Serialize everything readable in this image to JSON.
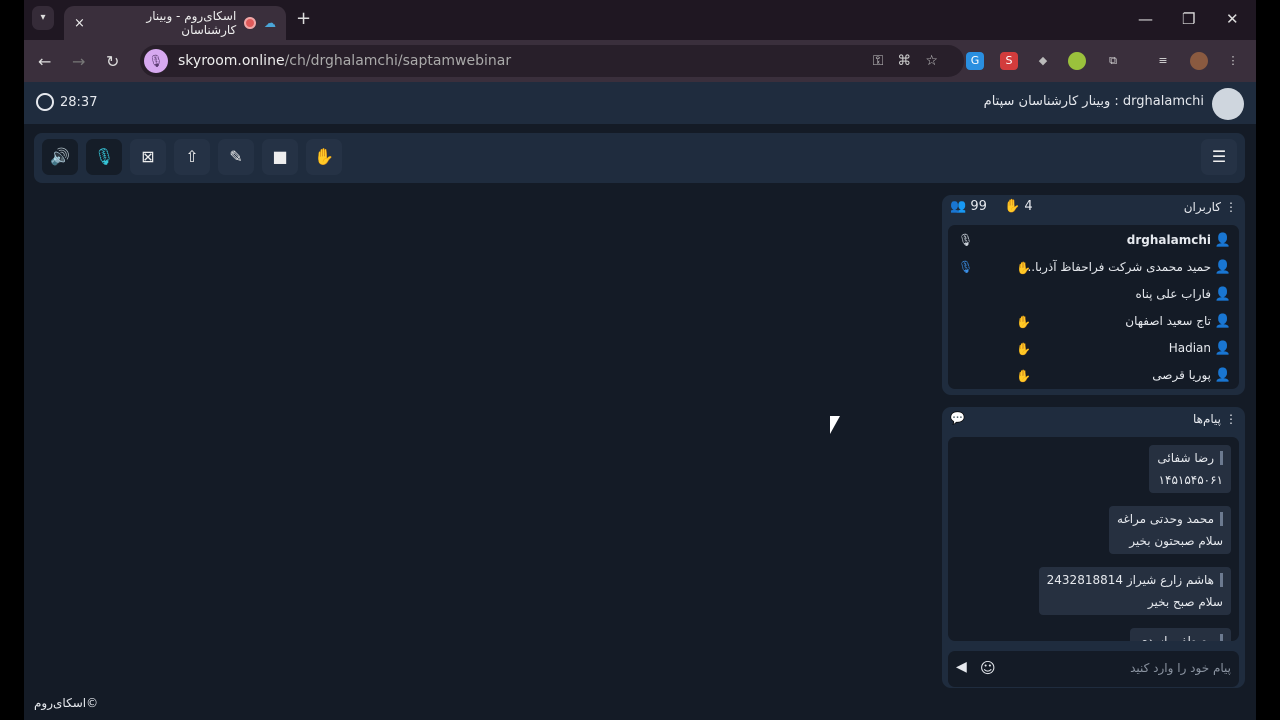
{
  "browser": {
    "tab_title": "اسکای‌روم - وبینار کارشناسان",
    "url_host": "skyroom.online",
    "url_path": "/ch/drghalamchi/saptamwebinar",
    "new_tab": "+",
    "close": "×"
  },
  "app": {
    "timer": "28:37",
    "room_title": "drghalamchi : وبینار کارشناسان سپتام",
    "footer": "©اسکای‌روم"
  },
  "users": {
    "title": "کاربران",
    "count": "99",
    "hands": "4",
    "list": [
      {
        "name": "drghalamchi",
        "color": "#3b8fe6",
        "hand": false,
        "mic": "#cfd6de"
      },
      {
        "name": "حمید محمدی شرکت فراحفاظ آذربا...",
        "color": "#6ee03c",
        "hand": true,
        "mic": "#3b8fe6"
      },
      {
        "name": "فاراب علی پناه",
        "color": "#6ee03c",
        "hand": false,
        "mic": ""
      },
      {
        "name": "تاج سعید اصفهان",
        "color": "#f2e04a",
        "hand": true,
        "mic": ""
      },
      {
        "name": "Hadian",
        "color": "#f2e04a",
        "hand": true,
        "mic": ""
      },
      {
        "name": "پوریا قرصی",
        "color": "#f2e04a",
        "hand": true,
        "mic": ""
      }
    ]
  },
  "chat": {
    "title": "پیام‌ها",
    "placeholder": "پیام خود را وارد کنید",
    "messages": [
      {
        "sender": "رضا شفائی",
        "text": "۱۴۵۱۵۴۵۰۶۱"
      },
      {
        "sender": "محمد وحدتی مراغه",
        "text": "سلام صبحتون بخیر"
      },
      {
        "sender": "هاشم زارع شیراز 2432818814",
        "text": "سلام صبح بخیر"
      },
      {
        "sender": "مصطفی اسدی",
        "text": ""
      }
    ]
  }
}
